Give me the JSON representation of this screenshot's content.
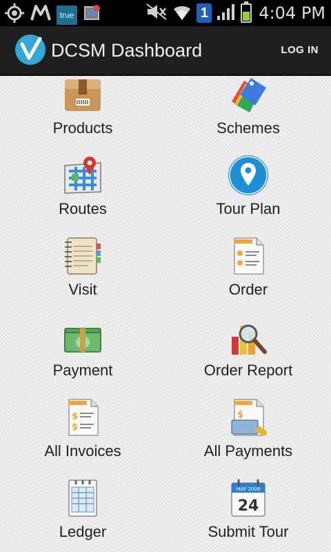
{
  "status_bar": {
    "time": "4:04 PM",
    "badge_true": "true",
    "sim_number": "1",
    "icons": [
      "gps-icon",
      "m-icon",
      "true-app-icon",
      "photo-icon",
      "mute-icon",
      "wifi-icon",
      "sim-icon",
      "signal-icon",
      "battery-icon"
    ]
  },
  "action_bar": {
    "title": "DCSM Dashboard",
    "login_label": "LOG IN",
    "logo": "dcsm-logo"
  },
  "dashboard": {
    "items": [
      {
        "label": "Products",
        "icon": "package-icon"
      },
      {
        "label": "Schemes",
        "icon": "tags-icon"
      },
      {
        "label": "Routes",
        "icon": "map-pin-icon"
      },
      {
        "label": "Tour Plan",
        "icon": "location-pin-icon"
      },
      {
        "label": "Visit",
        "icon": "notebook-icon"
      },
      {
        "label": "Order",
        "icon": "order-document-icon"
      },
      {
        "label": "Payment",
        "icon": "money-icon"
      },
      {
        "label": "Order Report",
        "icon": "report-magnifier-icon"
      },
      {
        "label": "All Invoices",
        "icon": "invoice-icon"
      },
      {
        "label": "All Payments",
        "icon": "pay-card-icon"
      },
      {
        "label": "Ledger",
        "icon": "ledger-icon"
      },
      {
        "label": "Submit Tour",
        "icon": "calendar-icon",
        "calendar_month": "MAY 2009",
        "calendar_day": "24"
      }
    ]
  },
  "colors": {
    "status_bar_bg": "#000000",
    "action_bar_bg": "#1f1f1f",
    "accent_blue": "#35a6d8",
    "content_bg": "#eeeeee"
  }
}
